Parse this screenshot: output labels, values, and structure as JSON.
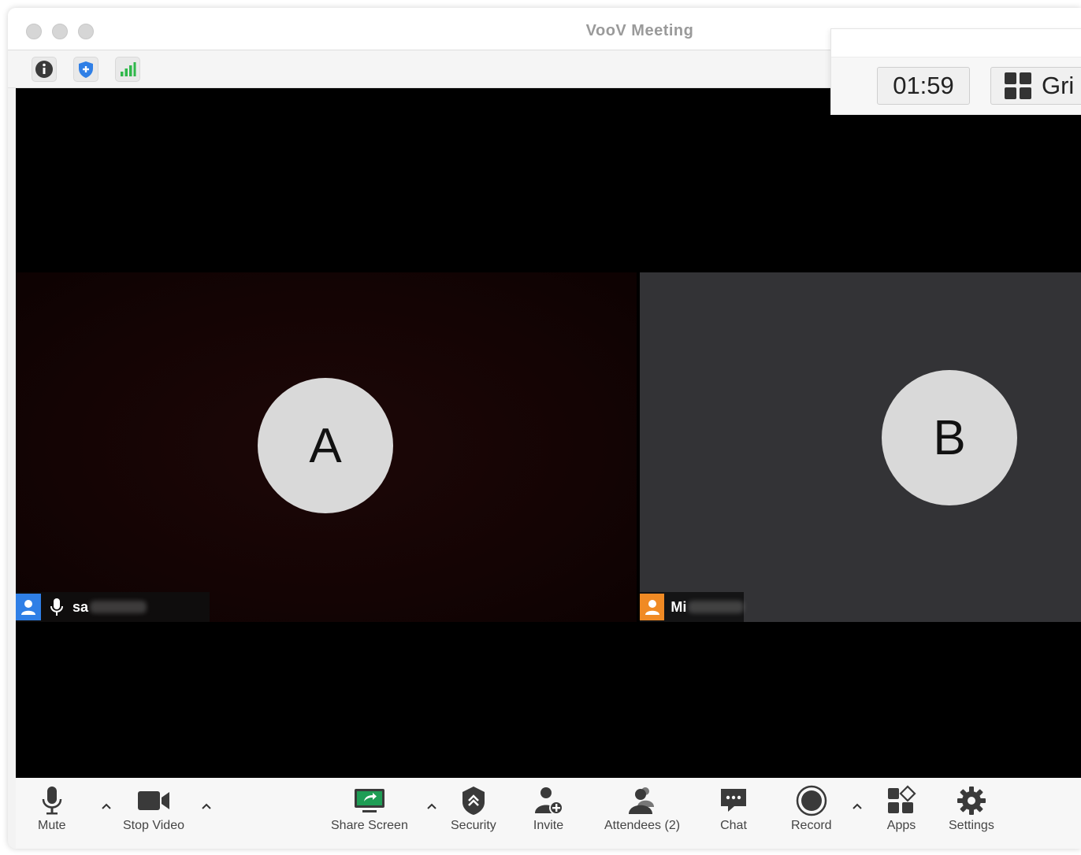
{
  "window": {
    "title": "VooV Meeting"
  },
  "meeting": {
    "timer": "01:59",
    "layout_button_label": "Gri"
  },
  "participants": [
    {
      "initial": "A",
      "name_visible": "sa"
    },
    {
      "initial": "B",
      "name_visible": "Mi"
    }
  ],
  "toolbar": {
    "mute": "Mute",
    "stop_video": "Stop Video",
    "share_screen": "Share Screen",
    "security": "Security",
    "invite": "Invite",
    "attendees": "Attendees (2)",
    "chat": "Chat",
    "record": "Record",
    "apps": "Apps",
    "settings": "Settings"
  },
  "icons": {
    "info": "info-icon",
    "shield": "shield-icon",
    "signal": "signal-icon",
    "grid": "grid-icon"
  },
  "colors": {
    "accent_blue": "#2f7fe6",
    "avatar_orange": "#f08a24",
    "signal_green": "#2fb84a",
    "share_green": "#1f9d55"
  }
}
